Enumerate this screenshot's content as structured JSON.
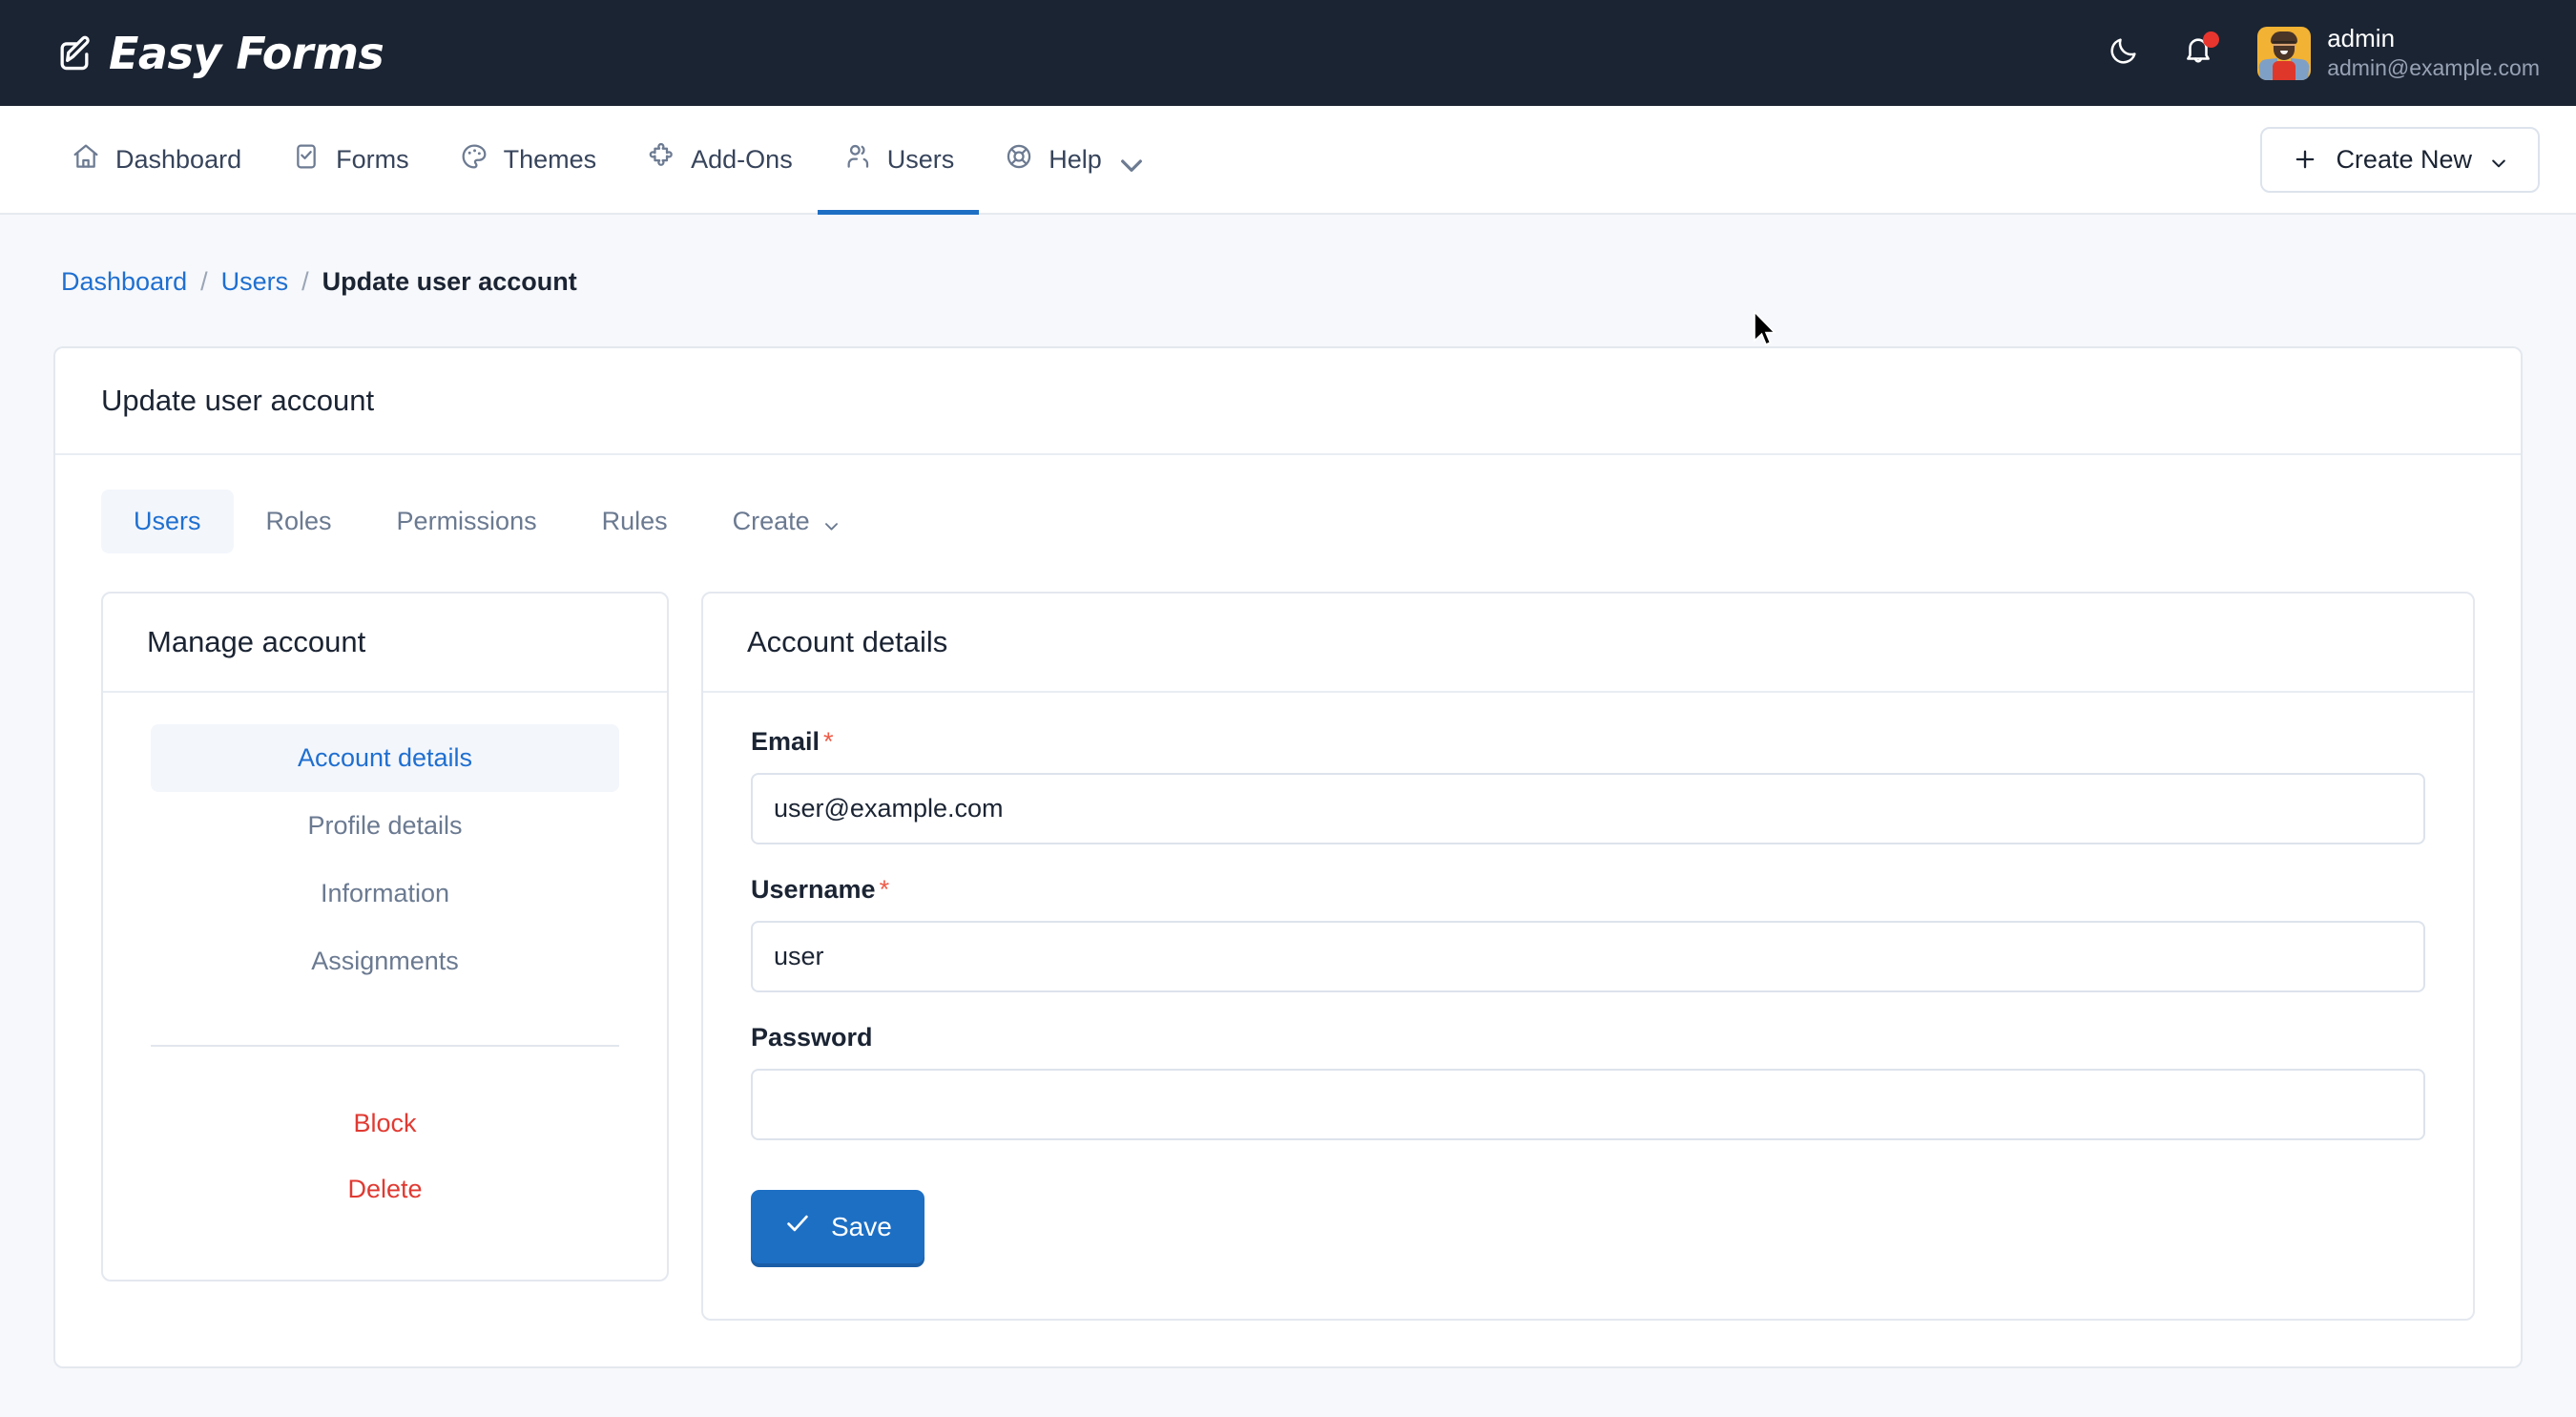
{
  "topbar": {
    "brand": "Easy Forms",
    "brand_icon": "pencil-square-icon",
    "dark_mode_icon": "moon-icon",
    "notifications_icon": "bell-icon",
    "user_name": "admin",
    "user_email": "admin@example.com"
  },
  "nav": {
    "items": [
      {
        "label": "Dashboard",
        "icon": "home-icon",
        "active": false
      },
      {
        "label": "Forms",
        "icon": "clipboard-check-icon",
        "active": false
      },
      {
        "label": "Themes",
        "icon": "palette-icon",
        "active": false
      },
      {
        "label": "Add-Ons",
        "icon": "puzzle-icon",
        "active": false
      },
      {
        "label": "Users",
        "icon": "users-icon",
        "active": true
      },
      {
        "label": "Help",
        "icon": "lifebuoy-icon",
        "active": false
      }
    ],
    "create_label": "Create New"
  },
  "breadcrumb": {
    "item1": "Dashboard",
    "item2": "Users",
    "current": "Update user account",
    "sep": "/"
  },
  "panel": {
    "title": "Update user account",
    "tabs": [
      {
        "label": "Users",
        "active": true
      },
      {
        "label": "Roles",
        "active": false
      },
      {
        "label": "Permissions",
        "active": false
      },
      {
        "label": "Rules",
        "active": false
      },
      {
        "label": "Create",
        "active": false,
        "dropdown": true
      }
    ]
  },
  "manage_account": {
    "title": "Manage account",
    "links": [
      {
        "label": "Account details",
        "active": true
      },
      {
        "label": "Profile details",
        "active": false
      },
      {
        "label": "Information",
        "active": false
      },
      {
        "label": "Assignments",
        "active": false
      }
    ],
    "danger": [
      {
        "label": "Block"
      },
      {
        "label": "Delete"
      }
    ]
  },
  "account_details": {
    "title": "Account details",
    "fields": [
      {
        "label": "Email",
        "required": true,
        "value": "user@example.com",
        "placeholder": ""
      },
      {
        "label": "Username",
        "required": true,
        "value": "user",
        "placeholder": ""
      },
      {
        "label": "Password",
        "required": false,
        "value": "",
        "placeholder": ""
      }
    ],
    "save_label": "Save",
    "save_icon": "check-icon"
  },
  "colors": {
    "accent": "#1d6fc4",
    "link": "#1f6fd0",
    "danger": "#e03a32",
    "required": "#ef5b47",
    "topbar_bg": "#1b2433",
    "page_bg": "#f6f8fb",
    "badge": "#e8352e"
  }
}
